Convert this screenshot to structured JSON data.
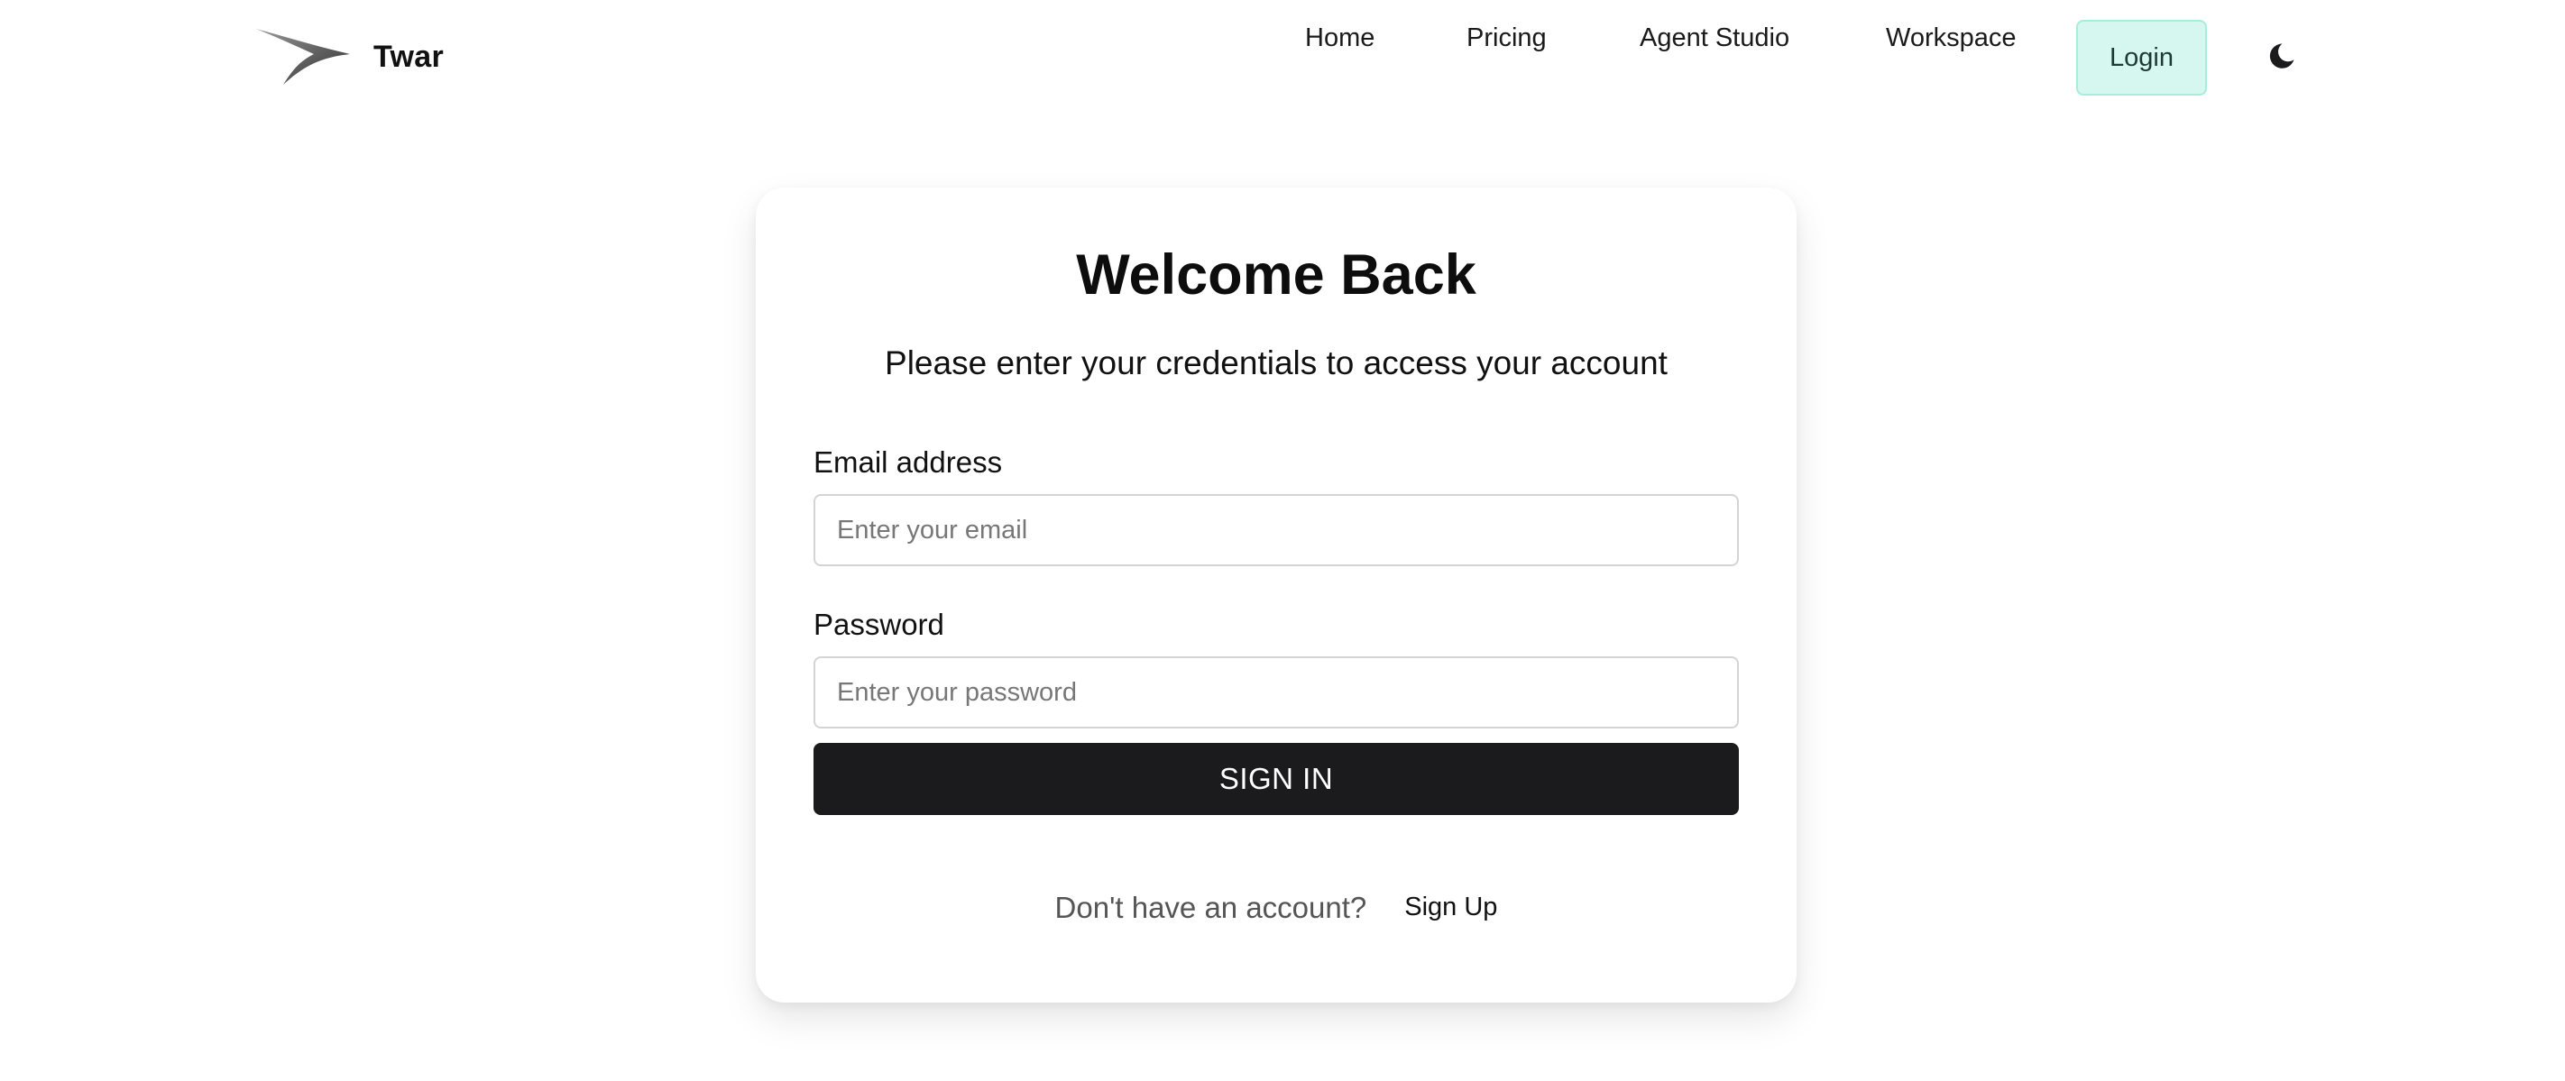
{
  "brand": {
    "name": "Twar",
    "logo_icon": "swallow-logo-icon"
  },
  "nav": {
    "items": [
      {
        "label": "Home"
      },
      {
        "label": "Pricing"
      },
      {
        "label": "Agent Studio"
      },
      {
        "label": "Workspace"
      }
    ],
    "login_label": "Login",
    "theme_toggle_icon": "moon-icon"
  },
  "login_card": {
    "title": "Welcome Back",
    "subtitle": "Please enter your credentials to access your account",
    "email": {
      "label": "Email address",
      "placeholder": "Enter your email",
      "value": ""
    },
    "password": {
      "label": "Password",
      "placeholder": "Enter your password",
      "value": ""
    },
    "submit_label": "SIGN IN",
    "signup_prompt": "Don't have an account?",
    "signup_link": "Sign Up"
  },
  "colors": {
    "login_button_bg": "#d6f7ef",
    "login_button_border": "#a8ecdb",
    "primary_button_bg": "#1b1b1d",
    "page_bg": "#ffffff"
  }
}
